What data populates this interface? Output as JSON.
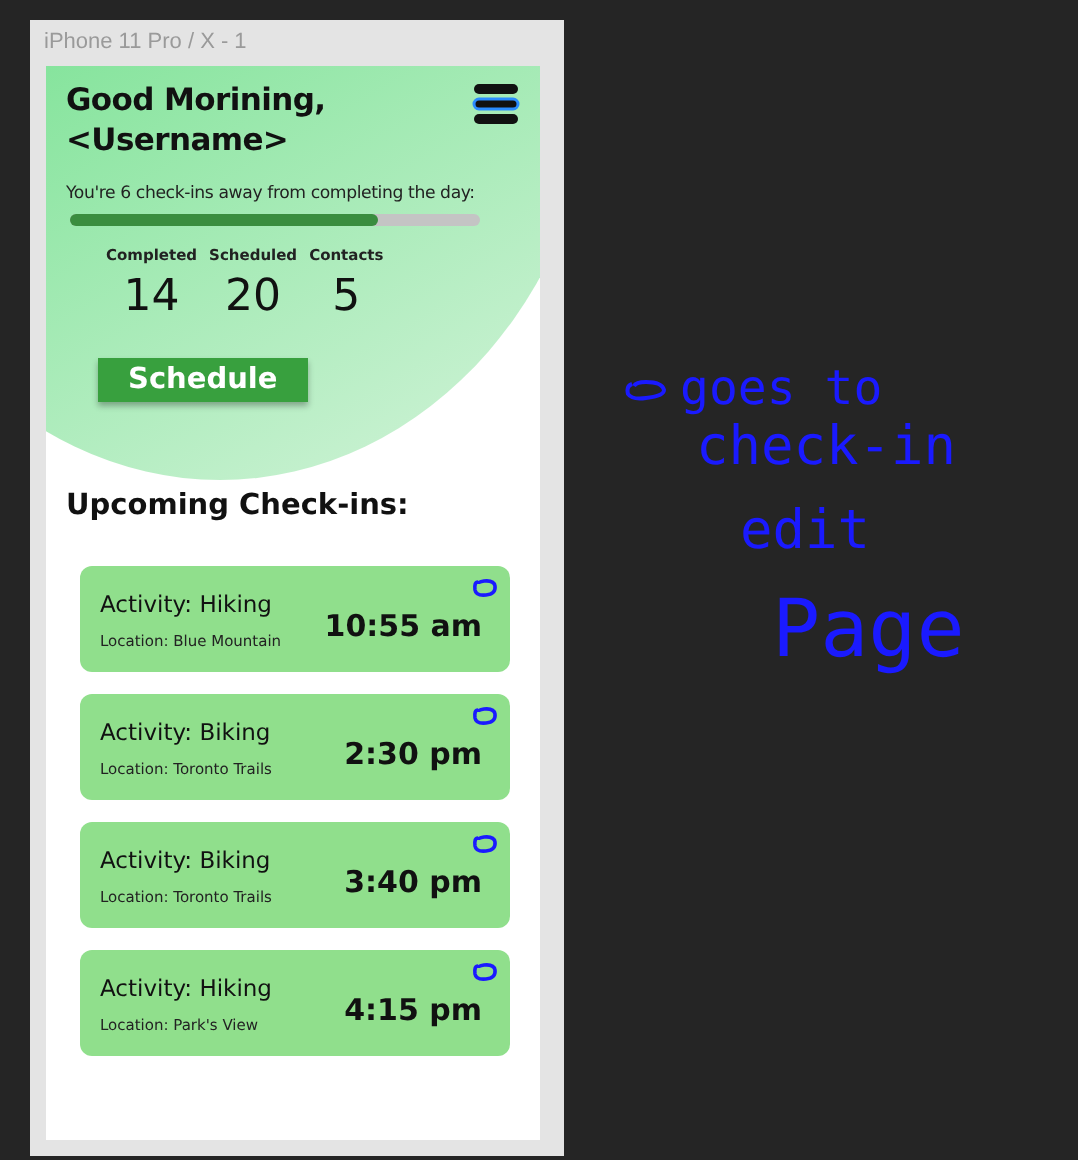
{
  "artboard": {
    "title": "iPhone 11 Pro / X - 1"
  },
  "header": {
    "greeting": "Good Morining,",
    "username": "<Username>",
    "progress_text": "You're 6 check-ins away from completing the day:",
    "progress": {
      "level": 0.75
    },
    "stats": [
      {
        "label": "Completed",
        "value": "14"
      },
      {
        "label": "Scheduled",
        "value": "20"
      },
      {
        "label": "Contacts",
        "value": "5"
      }
    ],
    "button": "Schedule"
  },
  "section_title": "Upcoming Check-ins:",
  "checkins": [
    {
      "activity": "Activity: Hiking",
      "location": "Location: Blue Mountain",
      "time": "10:55 am"
    },
    {
      "activity": "Activity: Biking",
      "location": "Location: Toronto Trails",
      "time": "2:30 pm"
    },
    {
      "activity": "Activity: Biking",
      "location": "Location: Toronto Trails",
      "time": "3:40 pm"
    },
    {
      "activity": "Activity: Hiking",
      "location": "Location:  Park's View",
      "time": "4:15 pm"
    }
  ],
  "annotation": {
    "lines": [
      "goes to",
      "check-in",
      "edit",
      "Page"
    ]
  }
}
